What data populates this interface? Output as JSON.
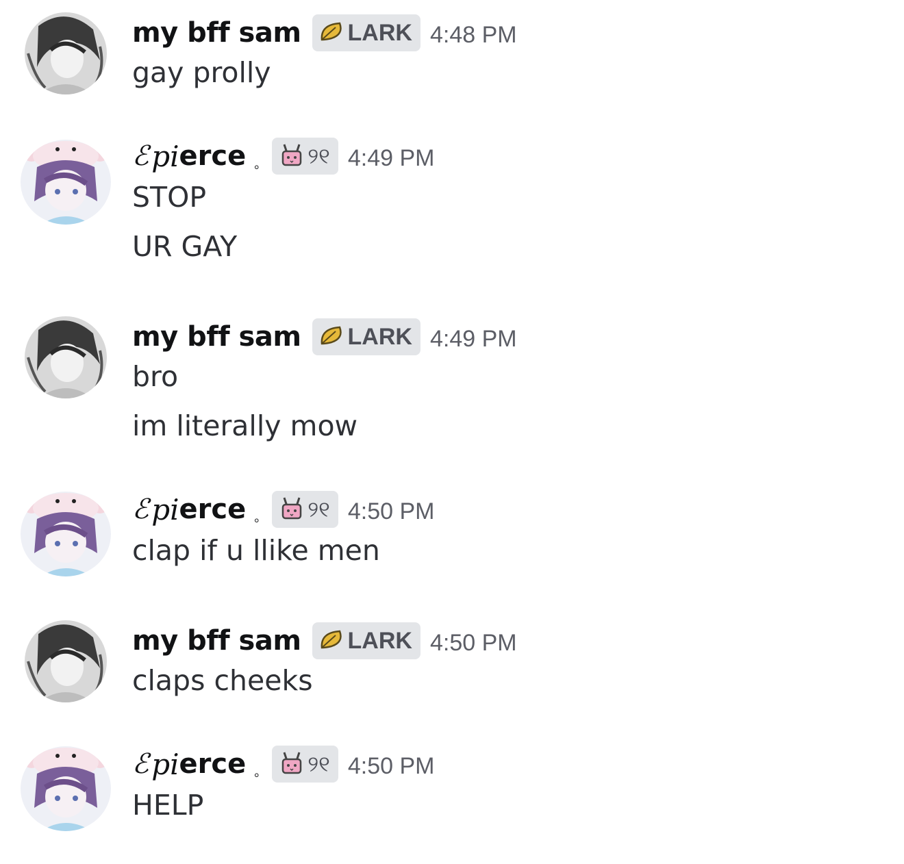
{
  "messages": [
    {
      "author": "my bff sam",
      "tag": "LARK",
      "time": "4:48 PM",
      "lines": [
        "gay prolly"
      ]
    },
    {
      "author_prefix": "ℰ",
      "author_script": "pi",
      "author_rest": "erce",
      "author_suffix": "。",
      "tag": "୨୧",
      "time": "4:49 PM",
      "lines": [
        "STOP",
        "UR GAY"
      ]
    },
    {
      "author": "my bff sam",
      "tag": "LARK",
      "time": "4:49 PM",
      "lines": [
        "bro",
        "im literally mow"
      ]
    },
    {
      "author_prefix": "ℰ",
      "author_script": "pi",
      "author_rest": "erce",
      "author_suffix": "。",
      "tag": "୨୧",
      "time": "4:50 PM",
      "lines": [
        "clap if u llike men"
      ]
    },
    {
      "author": "my bff sam",
      "tag": "LARK",
      "time": "4:50 PM",
      "lines": [
        "claps cheeks"
      ]
    },
    {
      "author_prefix": "ℰ",
      "author_script": "pi",
      "author_rest": "erce",
      "author_suffix": "。",
      "tag": "୨୧",
      "time": "4:50 PM",
      "lines": [
        "HELP"
      ]
    }
  ],
  "colors": {
    "tag_bg": "#e3e5e8",
    "leaf": "#e6b93a",
    "bunny": "#f0a7c4"
  },
  "icons": {
    "sam_tag_icon": "leaf-icon",
    "pierce_tag_icon": "bunny-icon"
  }
}
